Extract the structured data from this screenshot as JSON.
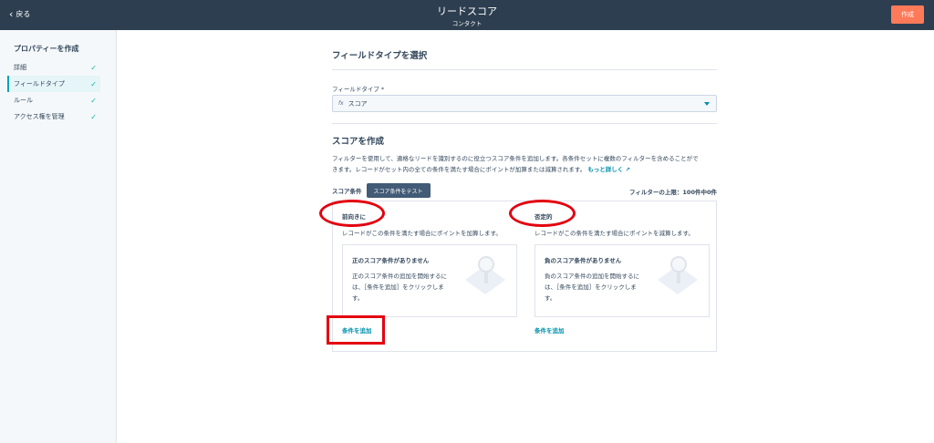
{
  "header": {
    "back_label": "戻る",
    "title": "リードスコア",
    "subtitle": "コンタクト",
    "create_label": "作成"
  },
  "sidebar": {
    "heading": "プロパティーを作成",
    "items": [
      {
        "label": "詳細"
      },
      {
        "label": "フィールドタイプ"
      },
      {
        "label": "ルール"
      },
      {
        "label": "アクセス権を管理"
      }
    ]
  },
  "main": {
    "field_type_heading": "フィールドタイプを選択",
    "field_type_label": "フィールドタイプ *",
    "field_type_value": "スコア",
    "field_type_icon_text": "fx",
    "score_heading": "スコアを作成",
    "description_line1": "フィルターを使用して、適格なリードを識別するのに役立つスコア条件を追加します。各条件セットに複数のフィルターを含めることがで",
    "description_line2": "きます。レコードがセット内の全ての条件を満たす場合にポイントが加算または減算されます。",
    "learn_more": "もっと詳しく",
    "score_conditions_label": "スコア条件",
    "test_button": "スコア条件をテスト",
    "filter_limit": "フィルターの上限：100件中0件",
    "positive": {
      "title": "前向きに",
      "subtitle": "レコードがこの条件を満たす場合にポイントを加算します。",
      "empty_title": "正のスコア条件がありません",
      "empty_body": "正のスコア条件の追加を開始するには、［条件を追加］をクリックします。",
      "add_label": "条件を追加"
    },
    "negative": {
      "title": "否定的",
      "subtitle": "レコードがこの条件を満たす場合にポイントを減算します。",
      "empty_title": "負のスコア条件がありません",
      "empty_body": "負のスコア条件の追加を開始するには、［条件を追加］をクリックします。",
      "add_label": "条件を追加"
    }
  },
  "colors": {
    "topbar": "#2d3e50",
    "accent": "#ff7a59",
    "link": "#0091ae",
    "check": "#00bda5",
    "annotation": "#e3000f"
  }
}
